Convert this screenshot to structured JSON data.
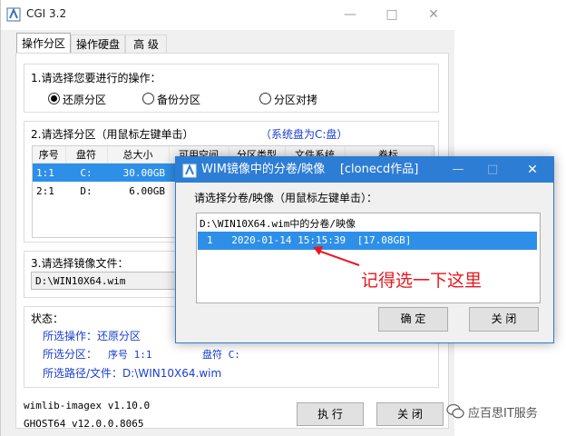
{
  "main": {
    "title": "CGI 3.2",
    "tabs": [
      "操作分区",
      "操作硬盘",
      "高 级"
    ],
    "step1_label": "1.请选择您要进行的操作：",
    "radios": [
      {
        "label": "还原分区",
        "selected": true
      },
      {
        "label": "备份分区",
        "selected": false
      },
      {
        "label": "分区对拷",
        "selected": false
      }
    ],
    "step2_label": "2.请选择分区（用鼠标左键单击）",
    "system_disk_note": "（系统盘为C:盘）",
    "partition_table": {
      "headers": [
        "序号",
        "盘符",
        "总大小",
        "可用空间",
        "分区类型",
        "文件系统",
        "卷标"
      ],
      "rows": [
        [
          "1:1",
          "C:",
          "30.00GB"
        ],
        [
          "2:1",
          "D:",
          "6.00GB"
        ]
      ],
      "selected_row": 0
    },
    "step3_label": "3.请选择镜像文件：",
    "image_path": "D:\\WIN10X64.wim",
    "status": {
      "title": "状态：",
      "operation": "所选操作：还原分区",
      "partition_label": "所选分区：",
      "index_text": "序号 1:1",
      "drive_text": "盘符 C:",
      "path": "所选路径/文件：D:\\WIN10X64.wim"
    },
    "footer": {
      "wimlib_version": "wimlib-imagex v1.10.0",
      "ghost_version": "GHOST64 v12.0.0.8065"
    },
    "buttons": {
      "execute": "执 行",
      "close": "关 闭"
    }
  },
  "dialog": {
    "title": "WIM镜像中的分卷/映像    [clonecd作品]",
    "prompt": "请选择分卷/映像（用鼠标左键单击）：",
    "list_header": "D:\\WIN10X64.wim中的分卷/映像",
    "items": [
      {
        "index": "1",
        "date": "2020-01-14 15:15:39",
        "size": "[17.08GB]"
      }
    ],
    "selected_item": 0,
    "buttons": {
      "ok": "确 定",
      "close": "关 闭"
    }
  },
  "annotation": {
    "text": "记得选一下这里",
    "color": "#e8191e"
  },
  "watermark": {
    "text": "应百思IT服务"
  },
  "colors": {
    "selection": "#2e8fe8",
    "dialog_title": "#2e7dd5",
    "link_blue": "#1a3ecf"
  }
}
